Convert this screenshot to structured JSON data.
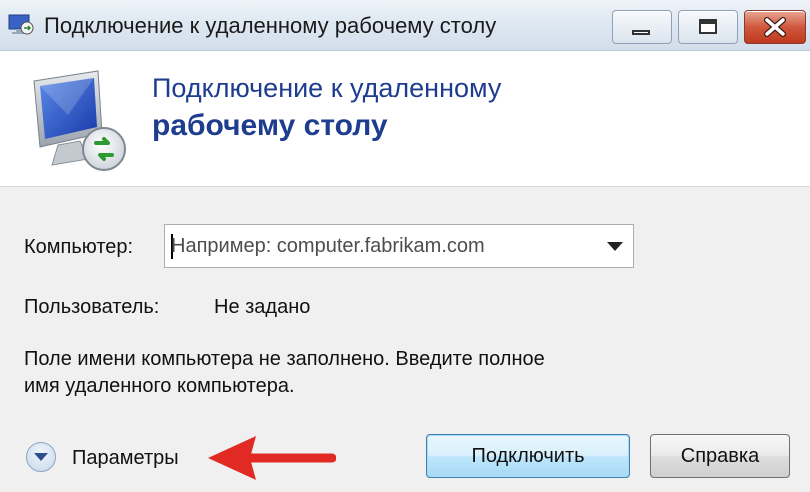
{
  "window": {
    "title": "Подключение к удаленному рабочему столу",
    "controls": {
      "minimize_icon": "minimize-icon",
      "maximize_icon": "maximize-icon",
      "close_icon": "close-icon"
    }
  },
  "header": {
    "line1": "Подключение к удаленному",
    "line2": "рабочему столу",
    "icon": "remote-desktop-monitor-icon",
    "title_color": "#1e3d8f"
  },
  "form": {
    "computer_label": "Компьютер:",
    "computer_placeholder": "Например: computer.fabrikam.com",
    "user_label": "Пользователь:",
    "user_value": "Не задано",
    "info_line1": "Поле имени компьютера не заполнено. Введите полное",
    "info_line2": "имя удаленного компьютера."
  },
  "footer": {
    "options_label": "Параметры",
    "connect_label": "Подключить",
    "help_label": "Справка",
    "annotation_arrow_color": "#e02a23"
  }
}
